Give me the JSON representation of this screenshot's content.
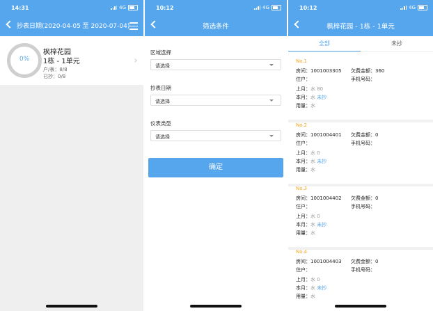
{
  "colors": {
    "accent": "#56a6ee",
    "number": "#f5a623",
    "bg": "#efefef"
  },
  "screen1": {
    "time": "14:31",
    "network": "4G",
    "title": "抄表日期(2020-04-05 至 2020-07-04)",
    "card": {
      "percent": "0%",
      "name": "枫梓花园",
      "unit": "1栋 - 1单元",
      "households": "户/表：8/8",
      "read": "已抄：0/8"
    }
  },
  "screen2": {
    "time": "10:12",
    "network": "4G",
    "title": "筛选条件",
    "filters": [
      {
        "label": "区域选择",
        "value": "请选择"
      },
      {
        "label": "抄表日期",
        "value": "请选择"
      },
      {
        "label": "仪表类型",
        "value": "请选择"
      }
    ],
    "confirm": "确定"
  },
  "screen3": {
    "time": "10:12",
    "network": "4G",
    "title": "枫梓花园 - 1栋 - 1单元",
    "tabs": [
      "全部",
      "未抄"
    ],
    "records": [
      {
        "no": "No.1",
        "room": "房间：1001003305",
        "owed": "欠费金额：360",
        "resident": "住户：",
        "phone": "手机号码：",
        "last_label": "上月：",
        "last_val": "水 80",
        "this_label": "本月：",
        "this_type": "水",
        "this_status": "未抄",
        "usage_label": "用量：",
        "usage_val": "水"
      },
      {
        "no": "No.2",
        "room": "房间：1001004401",
        "owed": "欠费金额：0",
        "resident": "住户：",
        "phone": "手机号码：",
        "last_label": "上月：",
        "last_val": "水 0",
        "this_label": "本月：",
        "this_type": "水",
        "this_status": "未抄",
        "usage_label": "用量：",
        "usage_val": "水"
      },
      {
        "no": "No.3",
        "room": "房间：1001004402",
        "owed": "欠费金额：0",
        "resident": "住户：",
        "phone": "手机号码：",
        "last_label": "上月：",
        "last_val": "水 0",
        "this_label": "本月：",
        "this_type": "水",
        "this_status": "未抄",
        "usage_label": "用量：",
        "usage_val": "水"
      },
      {
        "no": "No.4",
        "room": "房间：1001004403",
        "owed": "欠费金额：0",
        "resident": "住户：",
        "phone": "手机号码：",
        "last_label": "上月：",
        "last_val": "水 0",
        "this_label": "本月：",
        "this_type": "水",
        "this_status": "未抄",
        "usage_label": "用量：",
        "usage_val": "水"
      }
    ]
  }
}
